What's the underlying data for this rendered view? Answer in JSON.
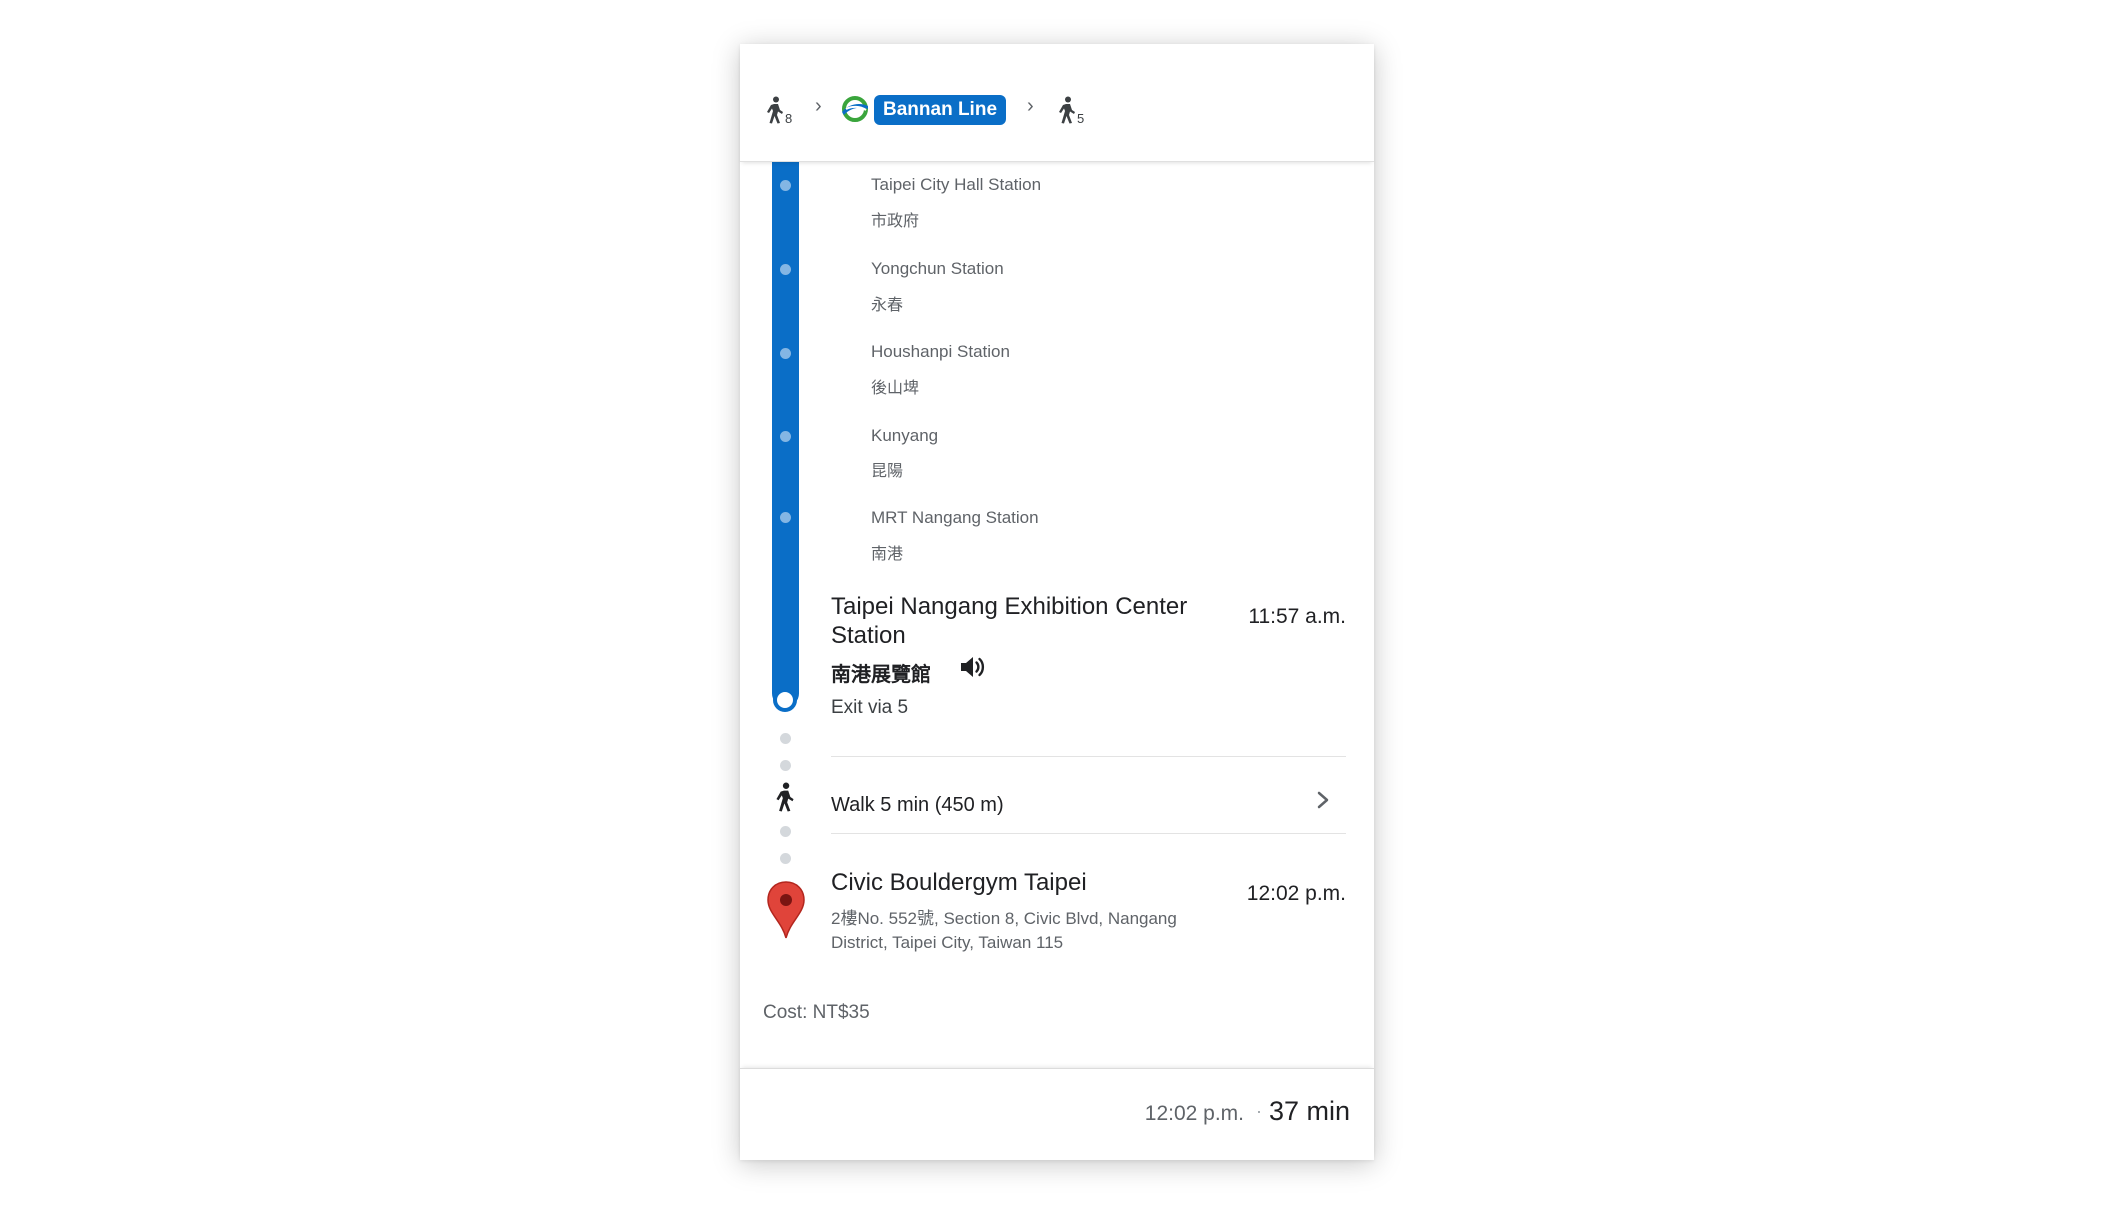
{
  "route_summary": {
    "walk_before_min": "8",
    "line_name": "Bannan Line",
    "walk_after_min": "5",
    "separator": "›"
  },
  "stops": [
    {
      "name": "Taipei City Hall Station",
      "local": "市政府"
    },
    {
      "name": "Yongchun Station",
      "local": "永春"
    },
    {
      "name": "Houshanpi Station",
      "local": "後山埤"
    },
    {
      "name": "Kunyang",
      "local": "昆陽"
    },
    {
      "name": "MRT Nangang Station",
      "local": "南港"
    }
  ],
  "arrival": {
    "name": "Taipei Nangang Exhibition Center Station",
    "local": "南港展覽館",
    "time": "11:57 a.m.",
    "exit": "Exit via 5"
  },
  "walk_step": {
    "label": "Walk 5 min (450 m)"
  },
  "destination": {
    "name": "Civic Bouldergym Taipei",
    "time": "12:02 p.m.",
    "address": "2樓No. 552號, Section 8, Civic Blvd, Nangang District, Taipei City, Taiwan 115"
  },
  "cost": "Cost: NT$35",
  "footer": {
    "arrival_time": "12:02 p.m.",
    "separator": "·",
    "duration": "37 min"
  },
  "colors": {
    "line": "#0a6ec7",
    "pin": "#e0443a"
  },
  "icons": [
    "walk-icon",
    "mrt-logo-icon",
    "speaker-icon",
    "chevron-right-icon",
    "map-pin-icon"
  ]
}
